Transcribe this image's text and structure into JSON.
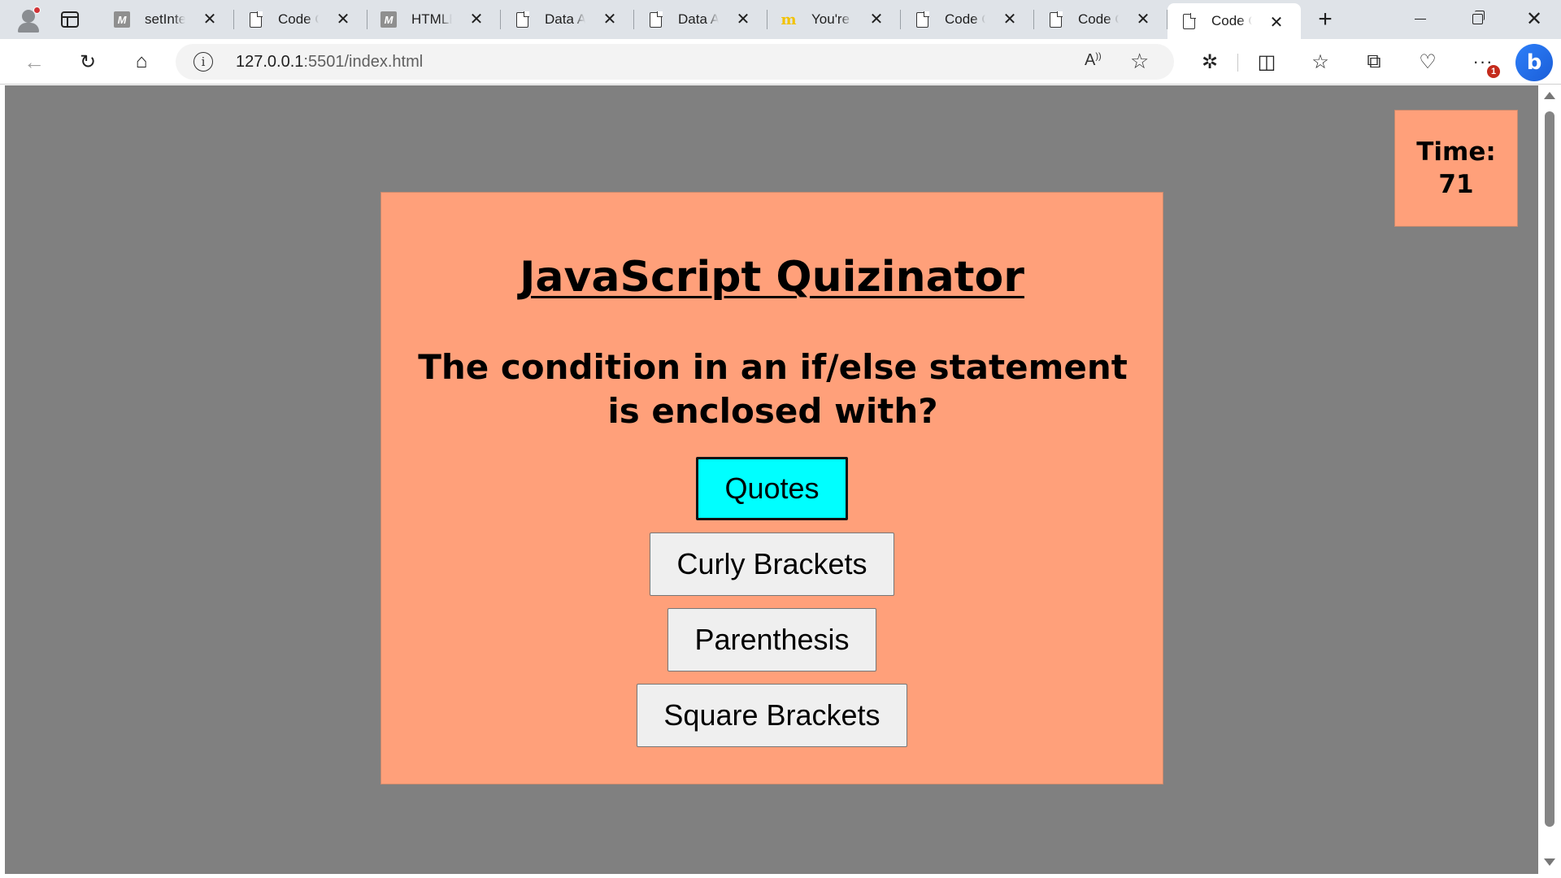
{
  "browser": {
    "tabs": [
      {
        "favicon": "mdn-icon",
        "title": "setInterv",
        "active": false
      },
      {
        "favicon": "document-icon",
        "title": "Code Qu",
        "active": false
      },
      {
        "favicon": "mdn-icon",
        "title": "HTMLEle",
        "active": false
      },
      {
        "favicon": "document-icon",
        "title": "Data Att",
        "active": false
      },
      {
        "favicon": "document-icon",
        "title": "Data Att",
        "active": false
      },
      {
        "favicon": "mcdonalds-icon",
        "title": "You're c",
        "active": false
      },
      {
        "favicon": "document-icon",
        "title": "Code Qu",
        "active": false
      },
      {
        "favicon": "document-icon",
        "title": "Code Qu",
        "active": false
      },
      {
        "favicon": "document-icon",
        "title": "Code Qu",
        "active": true
      }
    ],
    "address": {
      "host": "127.0.0.1",
      "rest": ":5501/index.html"
    },
    "notification_badge": "1"
  },
  "page": {
    "timer": {
      "label": "Time:",
      "value": "71"
    },
    "quiz": {
      "title": "JavaScript Quizinator",
      "question": "The condition in an if/else statement is enclosed with?",
      "answers": [
        {
          "label": "Quotes",
          "selected": true
        },
        {
          "label": "Curly Brackets",
          "selected": false
        },
        {
          "label": "Parenthesis",
          "selected": false
        },
        {
          "label": "Square Brackets",
          "selected": false
        }
      ]
    }
  },
  "colors": {
    "page_background": "#808080",
    "card_background": "#ffa07a",
    "selected_answer": "#00ffff",
    "answer_button": "#efefef"
  }
}
